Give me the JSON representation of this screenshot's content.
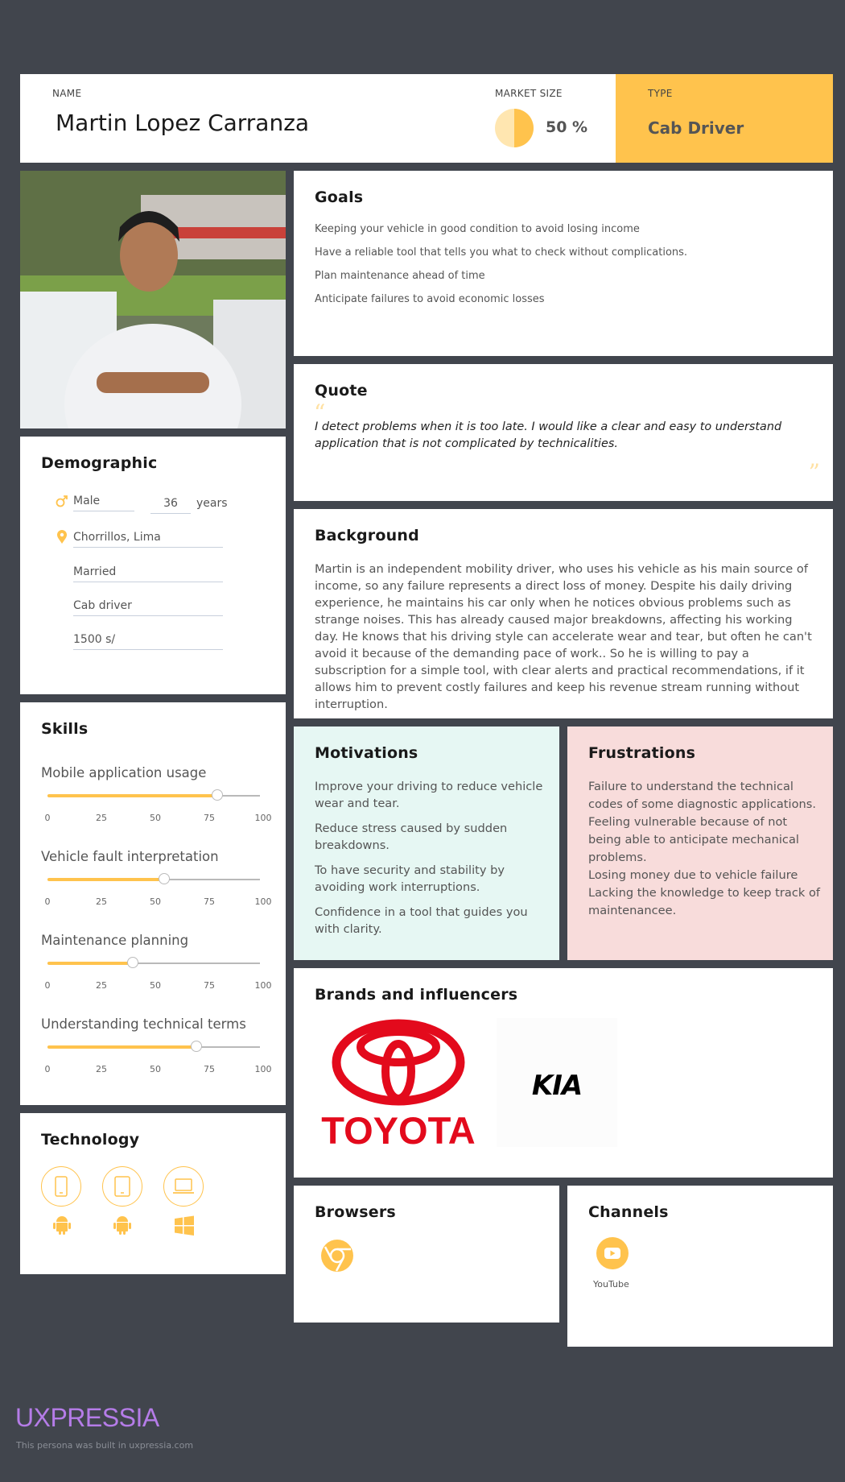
{
  "header": {
    "name_label": "NAME",
    "name": "Martin Lopez Carranza",
    "market_label": "MARKET SIZE",
    "market_value": "50 %",
    "market_fraction": 0.5,
    "type_label": "TYPE",
    "type_value": "Cab Driver"
  },
  "goals": {
    "title": "Goals",
    "items": [
      "Keeping your vehicle in good condition to avoid losing income",
      "Have a reliable tool that tells you what to check without complications.",
      "Plan maintenance ahead of time",
      "Anticipate failures to avoid economic losses"
    ]
  },
  "quote": {
    "title": "Quote",
    "text": "I detect problems when it is too late. I would like a clear and easy to understand application that is not complicated by technicalities."
  },
  "background": {
    "title": "Background",
    "text": "Martin is an independent mobility driver, who uses his vehicle as his main source of income, so any failure represents a direct loss of money. Despite his daily driving experience, he maintains his car only when he notices obvious problems such as strange noises. This has already caused major breakdowns, affecting his working day. He knows that his driving style can accelerate wear and tear, but often he can't avoid it because of the demanding pace of work.. So he is willing to pay a subscription for a simple tool, with clear alerts and practical recommendations, if it allows him to prevent costly failures and keep his revenue stream running without interruption."
  },
  "demographic": {
    "title": "Demographic",
    "gender": "Male",
    "age": "36",
    "age_unit": "years",
    "location": "Chorrillos, Lima",
    "marital": "Married",
    "occupation": "Cab driver",
    "income": "1500 s/"
  },
  "skills": {
    "title": "Skills",
    "ticks": [
      "0",
      "25",
      "50",
      "75",
      "100"
    ],
    "items": [
      {
        "label": "Mobile application usage",
        "value": 80
      },
      {
        "label": "Vehicle fault interpretation",
        "value": 55
      },
      {
        "label": "Maintenance planning",
        "value": 40
      },
      {
        "label": "Understanding technical terms",
        "value": 70
      }
    ]
  },
  "technology": {
    "title": "Technology",
    "devices": [
      "smartphone-icon",
      "tablet-icon",
      "laptop-icon"
    ],
    "platforms": [
      "android-icon",
      "android-icon",
      "windows-icon"
    ]
  },
  "motivations": {
    "title": "Motivations",
    "items": [
      "Improve your driving to reduce vehicle wear and tear.",
      "Reduce stress caused by sudden breakdowns.",
      "To have security and stability by avoiding work interruptions.",
      "Confidence in a tool that guides you with clarity."
    ]
  },
  "frustrations": {
    "title": "Frustrations",
    "text": "Failure to understand the technical codes of some diagnostic applications. Feeling vulnerable because of not being able to anticipate mechanical problems.\nLosing money due to vehicle failure\nLacking the knowledge to keep track of maintenancee."
  },
  "brands": {
    "title": "Brands and influencers",
    "items": [
      "TOYOTA",
      "KIA"
    ]
  },
  "browsers": {
    "title": "Browsers",
    "items": [
      "chrome-icon"
    ]
  },
  "channels": {
    "title": "Channels",
    "items": [
      "YouTube"
    ]
  },
  "footer": {
    "logo": "UXPRESSIA",
    "note": "This persona was built in uxpressia.com"
  },
  "colors": {
    "background": "#41454d",
    "accent": "#ffc34d",
    "motivations_bg": "#e6f7f3",
    "frustrations_bg": "#f8dcdb",
    "logo": "#b57ce8"
  }
}
